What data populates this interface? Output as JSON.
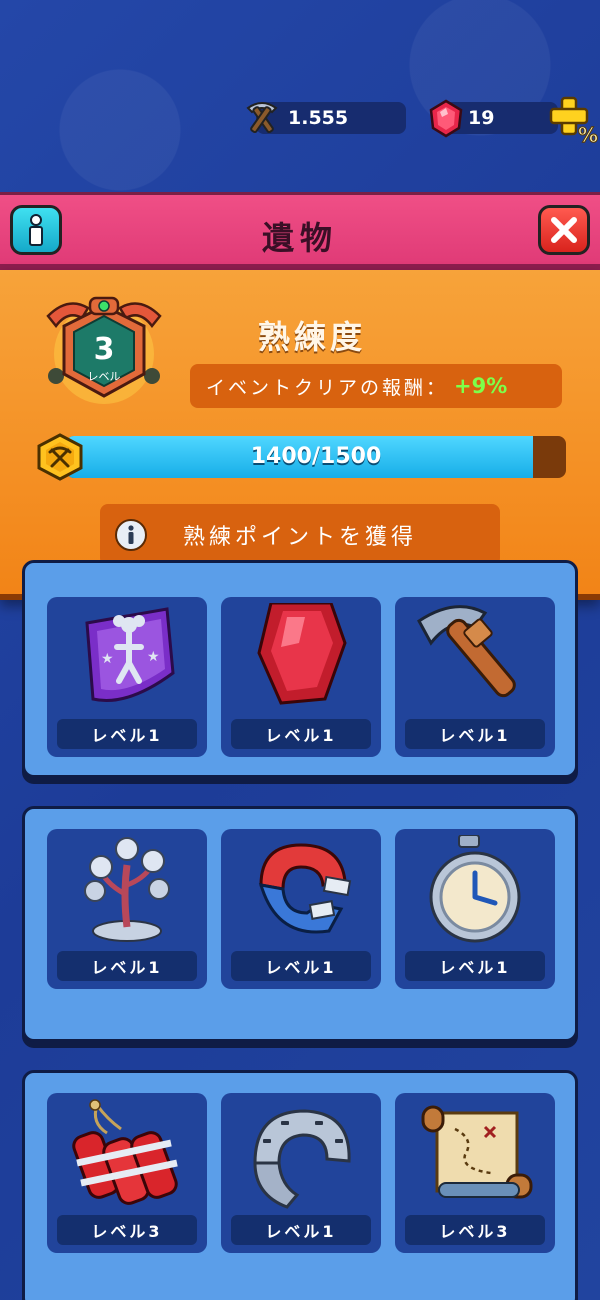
{
  "currency": {
    "pickaxe_amount": "1.555",
    "gem_amount": "19"
  },
  "header": {
    "title": "遺物"
  },
  "mastery": {
    "level": "3",
    "level_label": "レベル",
    "title": "熟練度",
    "reward_text": "イベントクリアの報酬：",
    "reward_bonus": "+9%",
    "progress_text": "1400/1500",
    "progress_fraction": 0.9333,
    "earn_button": "熟練ポイントを獲得"
  },
  "groups": [
    {
      "relics": [
        {
          "icon": "cheerleader-badge-icon",
          "level": "レベル1"
        },
        {
          "icon": "ruby-crystal-icon",
          "level": "レベル1"
        },
        {
          "icon": "pickaxe-icon",
          "level": "レベル1"
        }
      ]
    },
    {
      "relics": [
        {
          "icon": "coin-tree-icon",
          "level": "レベル1"
        },
        {
          "icon": "magnet-icon",
          "level": "レベル1"
        },
        {
          "icon": "stopwatch-icon",
          "level": "レベル1"
        }
      ]
    },
    {
      "relics": [
        {
          "icon": "dynamite-icon",
          "level": "レベル3"
        },
        {
          "icon": "horseshoe-icon",
          "level": "レベル1"
        },
        {
          "icon": "treasure-map-icon",
          "level": "レベル3"
        }
      ]
    }
  ],
  "colors": {
    "header_pink": "#e03b77",
    "panel_orange": "#f28417",
    "progress_blue": "#17aee8",
    "bonus_green": "#7dff4a",
    "card_blue": "#21449b"
  }
}
